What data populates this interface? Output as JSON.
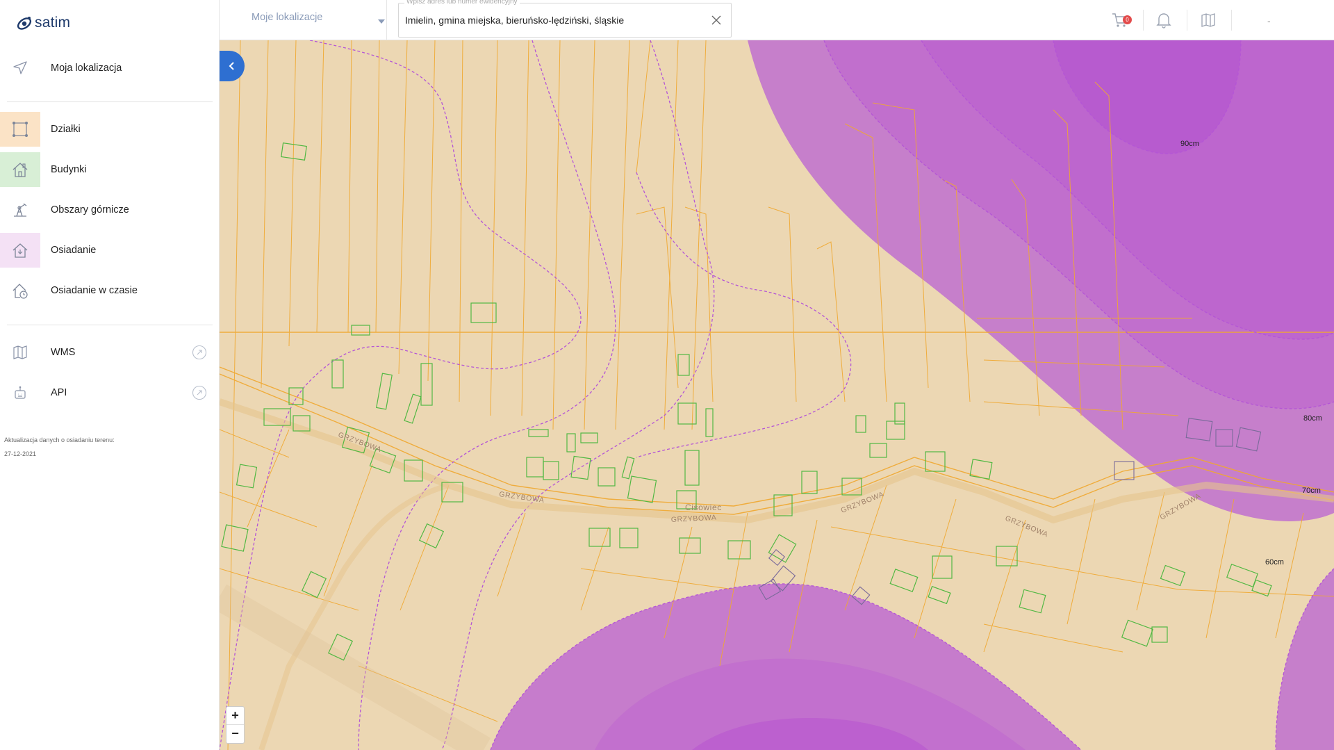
{
  "app": {
    "logo_text": "satim"
  },
  "sidebar": {
    "location_item": {
      "label": "Moja lokalizacja",
      "icon": "navigation-arrow-icon"
    },
    "layers": [
      {
        "label": "Działki",
        "icon": "parcel-icon",
        "bg": "#fbe3c6"
      },
      {
        "label": "Budynki",
        "icon": "building-icon",
        "bg": "#d8efd6"
      },
      {
        "label": "Obszary górnicze",
        "icon": "mining-icon",
        "bg": ""
      },
      {
        "label": "Osiadanie",
        "icon": "subsidence-house-icon",
        "bg": "#f4e1f5"
      },
      {
        "label": "Osiadanie w czasie",
        "icon": "house-clock-icon",
        "bg": ""
      }
    ],
    "services": [
      {
        "label": "WMS",
        "icon": "map-icon"
      },
      {
        "label": "API",
        "icon": "api-icon"
      }
    ],
    "update_note": {
      "label": "Aktualizacja danych o osiadaniu terenu:",
      "date": "27-12-2021"
    }
  },
  "topbar": {
    "location_select": "Moje lokalizacje",
    "search": {
      "legend": "Wpisz adres lub numer ewidencyjny",
      "value": "Imielin, gmina miejska, bieruńsko-lędziński, śląskie"
    },
    "cart_count": "0",
    "user_label": "-"
  },
  "map": {
    "colors": {
      "base": "#ecd7b3",
      "parcel_line": "#f0a830",
      "building": "#52b843",
      "subsidence_fill": "#c06bd1",
      "contour": "#b455d6"
    },
    "contour_labels": [
      "90cm",
      "80cm",
      "70cm",
      "60cm"
    ],
    "street_labels": [
      "GRZYBOWA",
      "GRZYBOWA",
      "GRZYBOWA",
      "GRZYBOWA",
      "GRZYBOWA",
      "GRZYBOWA"
    ],
    "place_label": "Cisowiec",
    "zoom_in": "+",
    "zoom_out": "−"
  }
}
